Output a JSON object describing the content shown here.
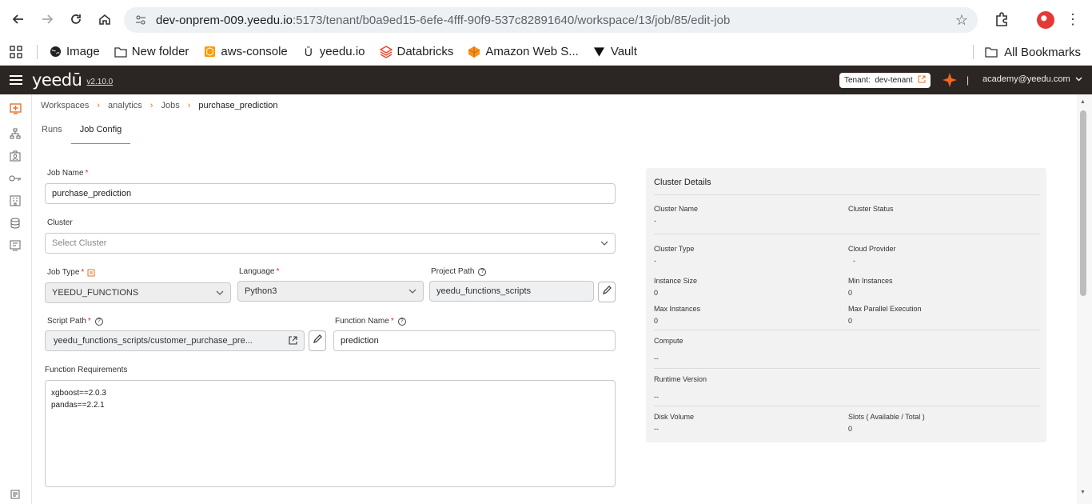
{
  "browser": {
    "url_host": "dev-onprem-009.yeedu.io",
    "url_path": ":5173/tenant/b0a9ed15-6efe-4fff-90f9-537c82891640/workspace/13/job/85/edit-job",
    "bookmarks": [
      "Image",
      "New folder",
      "aws-console",
      "yeedu.io",
      "Databricks",
      "Amazon Web S...",
      "Vault"
    ],
    "all_bookmarks": "All Bookmarks"
  },
  "header": {
    "logo": "yeedū",
    "version": "v2.10.0",
    "tenant_label": "Tenant:",
    "tenant_value": "dev-tenant",
    "divider": "|",
    "account": "academy@yeedu.com"
  },
  "breadcrumb": {
    "items": [
      "Workspaces",
      "analytics",
      "Jobs"
    ],
    "current": "purchase_prediction"
  },
  "tabs": [
    "Runs",
    "Job Config"
  ],
  "form": {
    "job_name_label": "Job Name",
    "job_name_value": "purchase_prediction",
    "cluster_label": "Cluster",
    "cluster_placeholder": "Select Cluster",
    "job_type_label": "Job Type",
    "job_type_value": "YEEDU_FUNCTIONS",
    "language_label": "Language",
    "language_value": "Python3",
    "project_path_label": "Project Path",
    "project_path_value": "yeedu_functions_scripts",
    "script_path_label": "Script Path",
    "script_path_value": "yeedu_functions_scripts/customer_purchase_pre...",
    "function_name_label": "Function Name",
    "function_name_value": "prediction",
    "requirements_label": "Function Requirements",
    "requirements_value": "xgboost==2.0.3\npandas==2.2.1",
    "required_mark": "*"
  },
  "cluster_details": {
    "title": "Cluster Details",
    "cluster_name_label": "Cluster Name",
    "cluster_name_value": "-",
    "cluster_status_label": "Cluster Status",
    "cluster_type_label": "Cluster Type",
    "cluster_type_value": "-",
    "cloud_provider_label": "Cloud Provider",
    "cloud_provider_value": "-",
    "instance_size_label": "Instance Size",
    "instance_size_value": "0",
    "min_instances_label": "Min Instances",
    "min_instances_value": "0",
    "max_instances_label": "Max Instances",
    "max_instances_value": "0",
    "max_parallel_label": "Max Parallel Execution",
    "max_parallel_value": "0",
    "compute_label": "Compute",
    "compute_value": "--",
    "runtime_label": "Runtime Version",
    "runtime_value": "--",
    "disk_label": "Disk Volume",
    "disk_value": "--",
    "slots_label": "Slots ( Available / Total )",
    "slots_value": "0"
  },
  "colors": {
    "accent": "#e8712a",
    "header_bg": "#2b2623",
    "required": "#d32f2f"
  }
}
